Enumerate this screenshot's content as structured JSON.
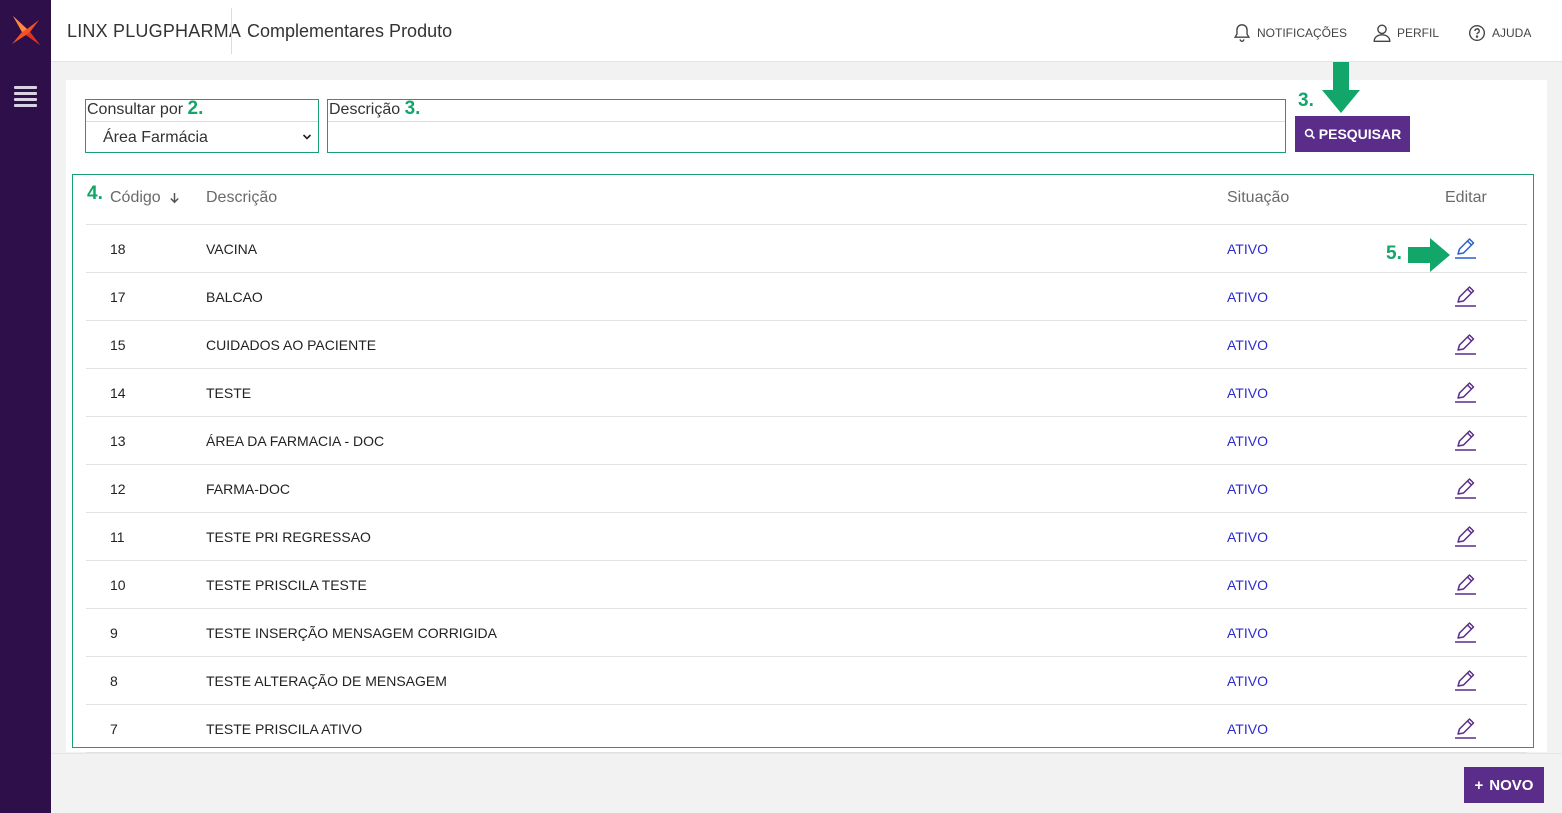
{
  "app": {
    "brand": "LINX PLUGPHARMA",
    "page_title": "Complementares Produto"
  },
  "header": {
    "notifications": "NOTIFICAÇÕES",
    "profile": "PERFIL",
    "help": "AJUDA"
  },
  "filters": {
    "consult_label": "Consultar por",
    "consult_step": "2.",
    "consult_value": "Área Farmácia",
    "desc_label": "Descrição",
    "desc_step": "3.",
    "desc_value": "",
    "search_step": "3.",
    "search_label": "PESQUISAR"
  },
  "table": {
    "step": "4.",
    "edit_step": "5.",
    "headers": {
      "code": "Código",
      "description": "Descrição",
      "status": "Situação",
      "edit": "Editar"
    },
    "rows": [
      {
        "code": "18",
        "description": "VACINA",
        "status": "ATIVO"
      },
      {
        "code": "17",
        "description": "BALCAO",
        "status": "ATIVO"
      },
      {
        "code": "15",
        "description": "CUIDADOS AO PACIENTE",
        "status": "ATIVO"
      },
      {
        "code": "14",
        "description": "TESTE",
        "status": "ATIVO"
      },
      {
        "code": "13",
        "description": "ÁREA DA FARMACIA - DOC",
        "status": "ATIVO"
      },
      {
        "code": "12",
        "description": "FARMA-DOC",
        "status": "ATIVO"
      },
      {
        "code": "11",
        "description": "TESTE PRI REGRESSAO",
        "status": "ATIVO"
      },
      {
        "code": "10",
        "description": "TESTE PRISCILA TESTE",
        "status": "ATIVO"
      },
      {
        "code": "9",
        "description": "TESTE INSERÇÃO MENSAGEM CORRIGIDA",
        "status": "ATIVO"
      },
      {
        "code": "8",
        "description": "TESTE ALTERAÇÃO DE MENSAGEM",
        "status": "ATIVO"
      },
      {
        "code": "7",
        "description": "TESTE PRISCILA ATIVO",
        "status": "ATIVO"
      }
    ]
  },
  "footer": {
    "new_label": "NOVO",
    "new_icon": "+"
  },
  "colors": {
    "sidebar": "#2e0f4a",
    "primary": "#5a2d8a",
    "annotation": "#13a66b",
    "status": "#2b2bd0"
  }
}
